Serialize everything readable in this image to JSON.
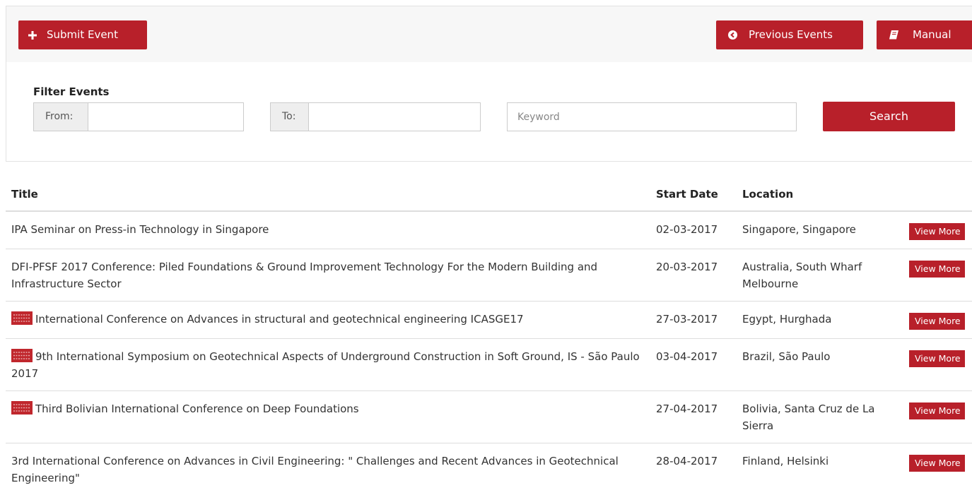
{
  "toolbar": {
    "submit_label": "Submit Event",
    "previous_label": "Previous Events",
    "manual_label": "Manual"
  },
  "filter": {
    "title": "Filter Events",
    "from_label": "From:",
    "from_value": "",
    "to_label": "To:",
    "to_value": "",
    "keyword_placeholder": "Keyword",
    "search_label": "Search"
  },
  "table": {
    "headers": {
      "title": "Title",
      "start_date": "Start Date",
      "location": "Location"
    },
    "rows": [
      {
        "title": "IPA Seminar on Press-in Technology in Singapore",
        "date": "02-03-2017",
        "location": "Singapore, Singapore",
        "action": "View More",
        "badge": false
      },
      {
        "title": "DFI-PFSF 2017 Conference: Piled Foundations & Ground Improvement Technology For the Modern Building and Infrastructure Sector",
        "date": "20-03-2017",
        "location": "Australia, South Wharf Melbourne",
        "action": "View More",
        "badge": false
      },
      {
        "title": "International Conference on Advances in structural and geotechnical engineering ICASGE17",
        "date": "27-03-2017",
        "location": "Egypt, Hurghada",
        "action": "View More",
        "badge": true
      },
      {
        "title": "9th International Symposium on Geotechnical Aspects of Underground Construction in Soft Ground, IS - São Paulo 2017",
        "date": "03-04-2017",
        "location": "Brazil, São Paulo",
        "action": "View More",
        "badge": true
      },
      {
        "title": "Third Bolivian International Conference on Deep Foundations",
        "date": "27-04-2017",
        "location": "Bolivia, Santa Cruz de La Sierra",
        "action": "View More",
        "badge": true
      },
      {
        "title": "3rd International Conference on Advances in Civil Engineering: \" Challenges and Recent Advances in Geotechnical Engineering\"",
        "date": "28-04-2017",
        "location": "Finland, Helsinki",
        "action": "View More",
        "badge": false
      }
    ]
  },
  "icons": {
    "submit": "plus-icon",
    "previous": "arrow-circle-left-icon",
    "manual": "book-icon",
    "row_badge": "issmge-logo-icon"
  },
  "colors": {
    "accent": "#b8202a",
    "toolbar_bg": "#f7f7f7",
    "addon_bg": "#eeeeee"
  }
}
